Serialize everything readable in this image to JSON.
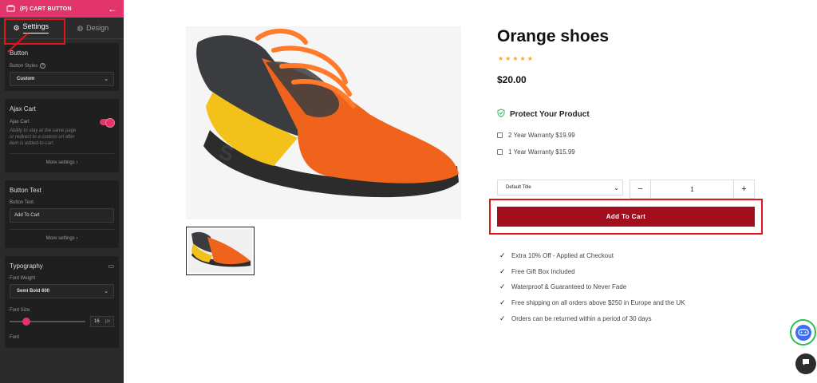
{
  "sidebar": {
    "header_title": "(P) CART BUTTON",
    "tabs": {
      "settings": "Settings",
      "design": "Design"
    },
    "button_section": {
      "title": "Button",
      "styles_label": "Button Styles",
      "styles_value": "Custom"
    },
    "ajax_section": {
      "title": "Ajax Cart",
      "toggle_label": "Ajax Cart",
      "toggle_on": true,
      "description": "Ability to stay at the same page or redirect to a custom url after item is added-to-cart.",
      "more": "More settings"
    },
    "text_section": {
      "title": "Button Text",
      "field_label": "Button Text",
      "field_value": "Add To Cart",
      "more": "More settings"
    },
    "typography_section": {
      "title": "Typography",
      "weight_label": "Font Weight",
      "weight_value": "Semi Bold 600",
      "size_label": "Font Size",
      "size_value": "16",
      "size_unit": "px",
      "next_label": "Font"
    }
  },
  "product": {
    "title": "Orange shoes",
    "rating": "★★★★★",
    "price": "$20.00",
    "protect_title": "Protect Your Product",
    "warranties": [
      "2 Year Warranty $19.99",
      "1 Year Warranty $15.99"
    ],
    "variant": "Default Title",
    "quantity": "1",
    "add_to_cart": "Add To Cart",
    "perks": [
      "Extra 10% Off - Applied at Checkout",
      "Free Gift Box Included",
      "Waterproof & Guaranteed to Never Fade",
      "Free shipping on all orders above $250 in Europe and the UK",
      "Orders can be returned within a period of 30 days"
    ]
  },
  "colors": {
    "brand_pink": "#e2336b",
    "cart_button": "#a10e1e",
    "highlight_red": "#e3141c",
    "star": "#f5a623"
  }
}
